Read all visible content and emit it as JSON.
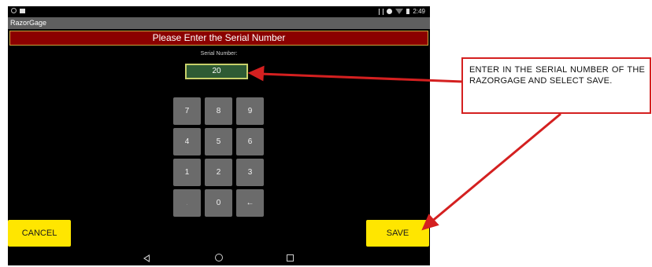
{
  "status_bar": {
    "time": "2:49",
    "left_icons": [
      "notification-icon",
      "image-icon"
    ],
    "right_icons": [
      "bluetooth-icon",
      "do-not-disturb-icon",
      "wifi-icon",
      "battery-icon"
    ]
  },
  "app": {
    "title": "RazorGage",
    "banner": "Please Enter the Serial Number",
    "serial_label": "Serial Number:",
    "serial_value": "20"
  },
  "keypad": {
    "keys": [
      "7",
      "8",
      "9",
      "4",
      "5",
      "6",
      "1",
      "2",
      "3",
      ".",
      "0",
      "←"
    ]
  },
  "buttons": {
    "cancel": "CANCEL",
    "save": "SAVE"
  },
  "nav_bar": {
    "icons": [
      "back-icon",
      "home-icon",
      "recent-apps-icon"
    ]
  },
  "annotation": {
    "text": "ENTER IN THE SERIAL NUMBER OF THE RAZORGAGE AND SELECT SAVE.",
    "color": "#d42020"
  },
  "colors": {
    "banner": "#8b0000",
    "button": "#ffe600",
    "input": "#2e5b34",
    "key": "#6b6b6b"
  }
}
